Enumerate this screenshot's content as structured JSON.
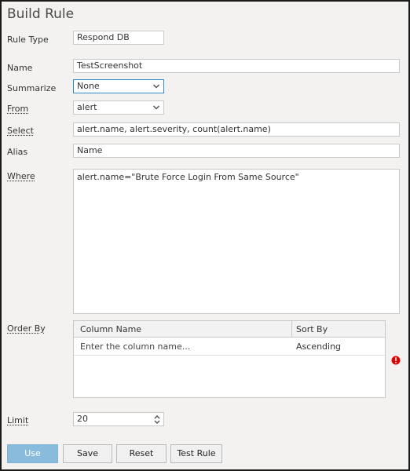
{
  "title": "Build Rule",
  "fields": {
    "rule_type": {
      "label": "Rule Type",
      "value": "Respond DB"
    },
    "name": {
      "label": "Name",
      "value": "TestScreenshot"
    },
    "summarize": {
      "label": "Summarize",
      "value": "None"
    },
    "from": {
      "label": "From",
      "value": "alert"
    },
    "select": {
      "label": "Select",
      "value": "alert.name, alert.severity, count(alert.name)"
    },
    "alias": {
      "label": "Alias",
      "value": "Name"
    },
    "where": {
      "label": "Where",
      "value": "alert.name=\"Brute Force Login From Same Source\""
    },
    "order_by": {
      "label": "Order By",
      "columns": [
        "Column Name",
        "Sort By"
      ],
      "rows": [
        {
          "column": "Enter the column name...",
          "sort": "Ascending"
        }
      ]
    },
    "limit": {
      "label": "Limit",
      "value": "20"
    }
  },
  "buttons": {
    "use": "Use",
    "save": "Save",
    "reset": "Reset",
    "test_rule": "Test Rule"
  },
  "colors": {
    "primary_button": "#89bcdc",
    "error": "#e00000",
    "focus_border": "#2d89c8"
  },
  "icons": {
    "dropdown": "chevron-down-icon",
    "spinner": "spinner-arrows-icon",
    "error": "error-icon"
  }
}
